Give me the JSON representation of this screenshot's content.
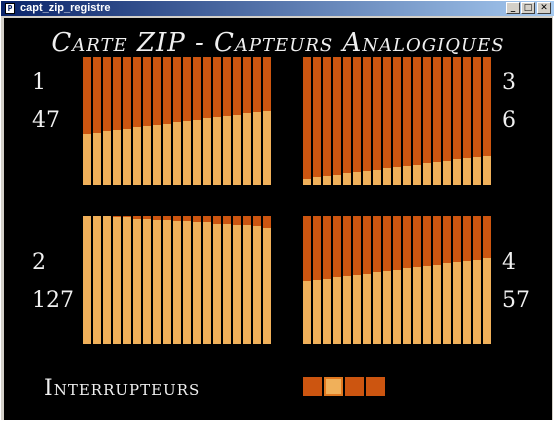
{
  "window": {
    "title": "capt_zip_registre",
    "icon_glyph": "P",
    "buttons": [
      "_",
      "□",
      "✕"
    ]
  },
  "heading": "Carte ZIP - Capteurs Analogiques",
  "sensors": [
    {
      "id": "1",
      "value": "47",
      "levels": [
        0.4,
        0.41,
        0.42,
        0.43,
        0.44,
        0.45,
        0.46,
        0.47,
        0.48,
        0.49,
        0.5,
        0.51,
        0.52,
        0.53,
        0.54,
        0.55,
        0.56,
        0.57,
        0.58
      ]
    },
    {
      "id": "2",
      "value": "127",
      "levels": [
        1.0,
        1.0,
        1.0,
        0.99,
        0.99,
        0.98,
        0.98,
        0.97,
        0.97,
        0.96,
        0.96,
        0.95,
        0.95,
        0.94,
        0.94,
        0.93,
        0.93,
        0.92,
        0.91
      ]
    },
    {
      "id": "3",
      "value": "6",
      "levels": [
        0.05,
        0.06,
        0.07,
        0.08,
        0.09,
        0.1,
        0.11,
        0.12,
        0.13,
        0.14,
        0.15,
        0.16,
        0.17,
        0.18,
        0.19,
        0.2,
        0.21,
        0.22,
        0.23
      ]
    },
    {
      "id": "4",
      "value": "57",
      "levels": [
        0.49,
        0.5,
        0.51,
        0.52,
        0.53,
        0.54,
        0.55,
        0.56,
        0.57,
        0.58,
        0.59,
        0.6,
        0.61,
        0.62,
        0.63,
        0.64,
        0.65,
        0.66,
        0.67
      ]
    }
  ],
  "switches": {
    "label": "Interrupteurs",
    "states": [
      false,
      true,
      false,
      false
    ]
  },
  "colors": {
    "bar_empty": "#cc5510",
    "bar_fill": "#f0b05a",
    "switch_off": "#cc5510",
    "switch_on": "#f0b05a",
    "switch_on_border": "#e07820",
    "background": "#000000",
    "text": "#f0f0f0"
  }
}
